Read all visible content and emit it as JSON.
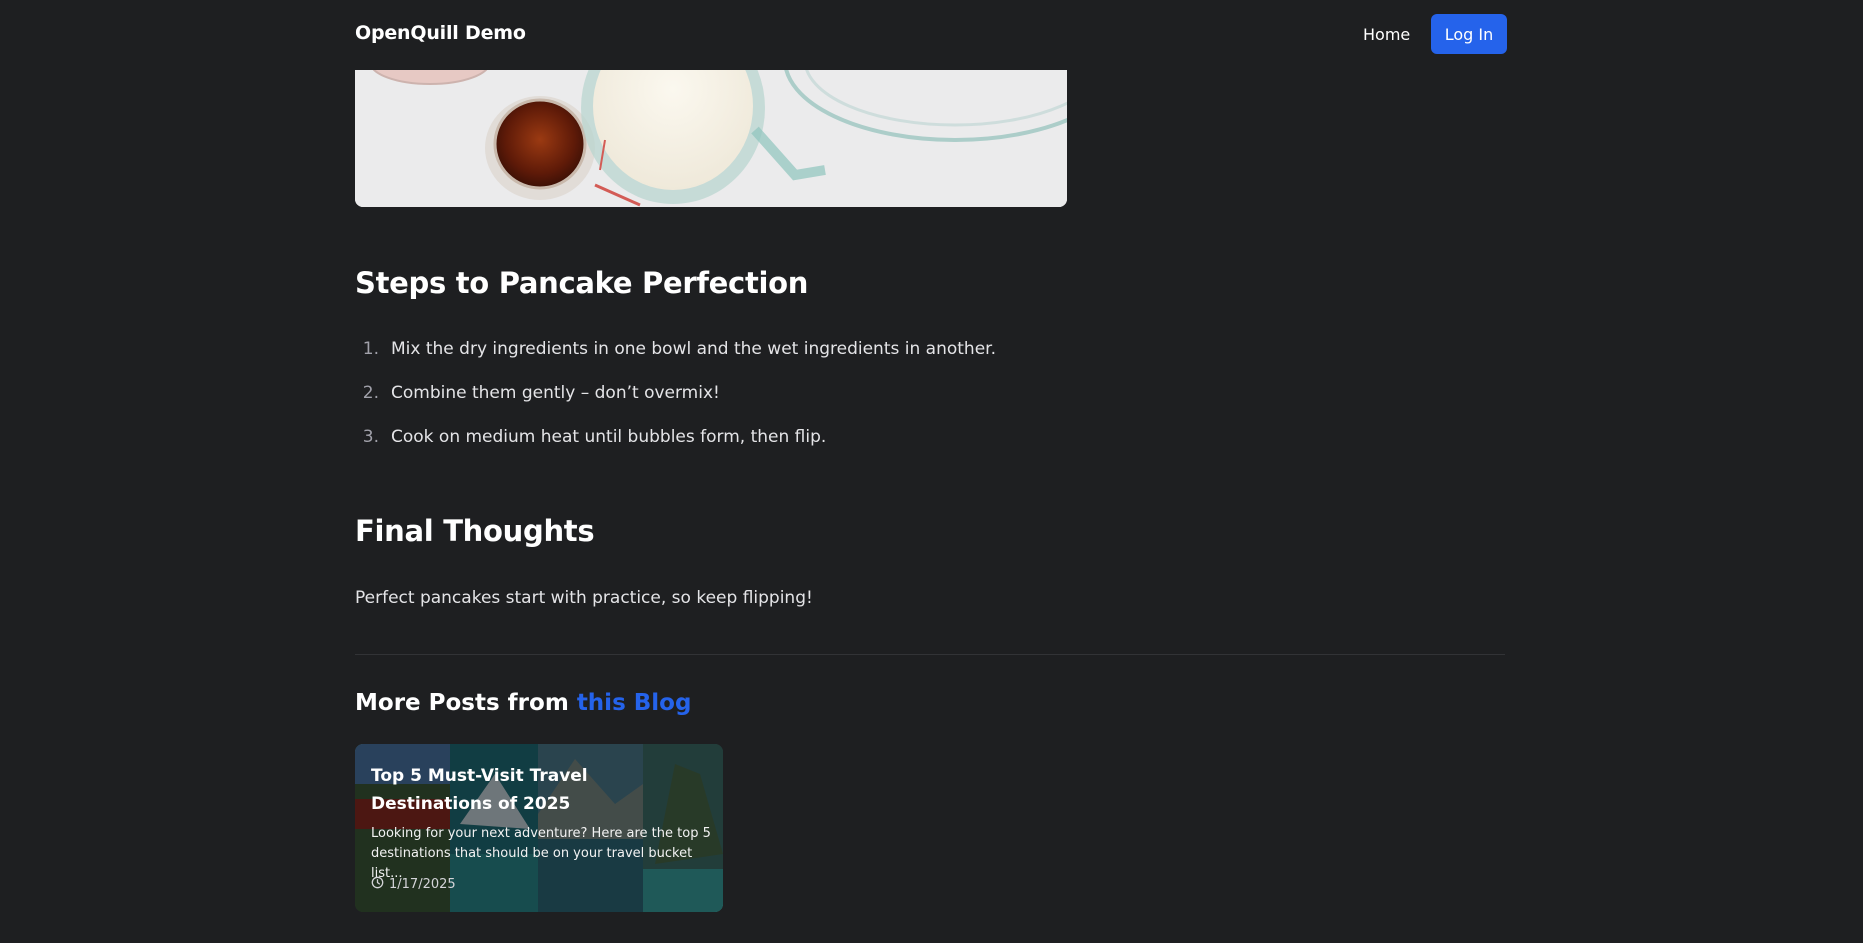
{
  "header": {
    "brand": "OpenQuill Demo",
    "nav_home": "Home",
    "nav_login": "Log In",
    "accent_color": "#2563eb"
  },
  "article": {
    "steps_heading": "Steps to Pancake Perfection",
    "steps": [
      {
        "number": "1.",
        "text": "Mix the dry ingredients in one bowl and the wet ingredients in another."
      },
      {
        "number": "2.",
        "text": "Combine them gently – don’t overmix!"
      },
      {
        "number": "3.",
        "text": "Cook on medium heat until bubbles form, then flip."
      }
    ],
    "final_heading": "Final Thoughts",
    "final_text": "Perfect pancakes start with practice, so keep flipping!"
  },
  "more_posts": {
    "heading_prefix": "More Posts from ",
    "heading_link": "this Blog",
    "cards": [
      {
        "title": "Top 5 Must-Visit Travel Destinations of 2025",
        "excerpt": "Looking for your next adventure? Here are the top 5 destinations that should be on your travel bucket list...",
        "date": "1/17/2025",
        "date_icon": "clock-icon"
      }
    ]
  }
}
